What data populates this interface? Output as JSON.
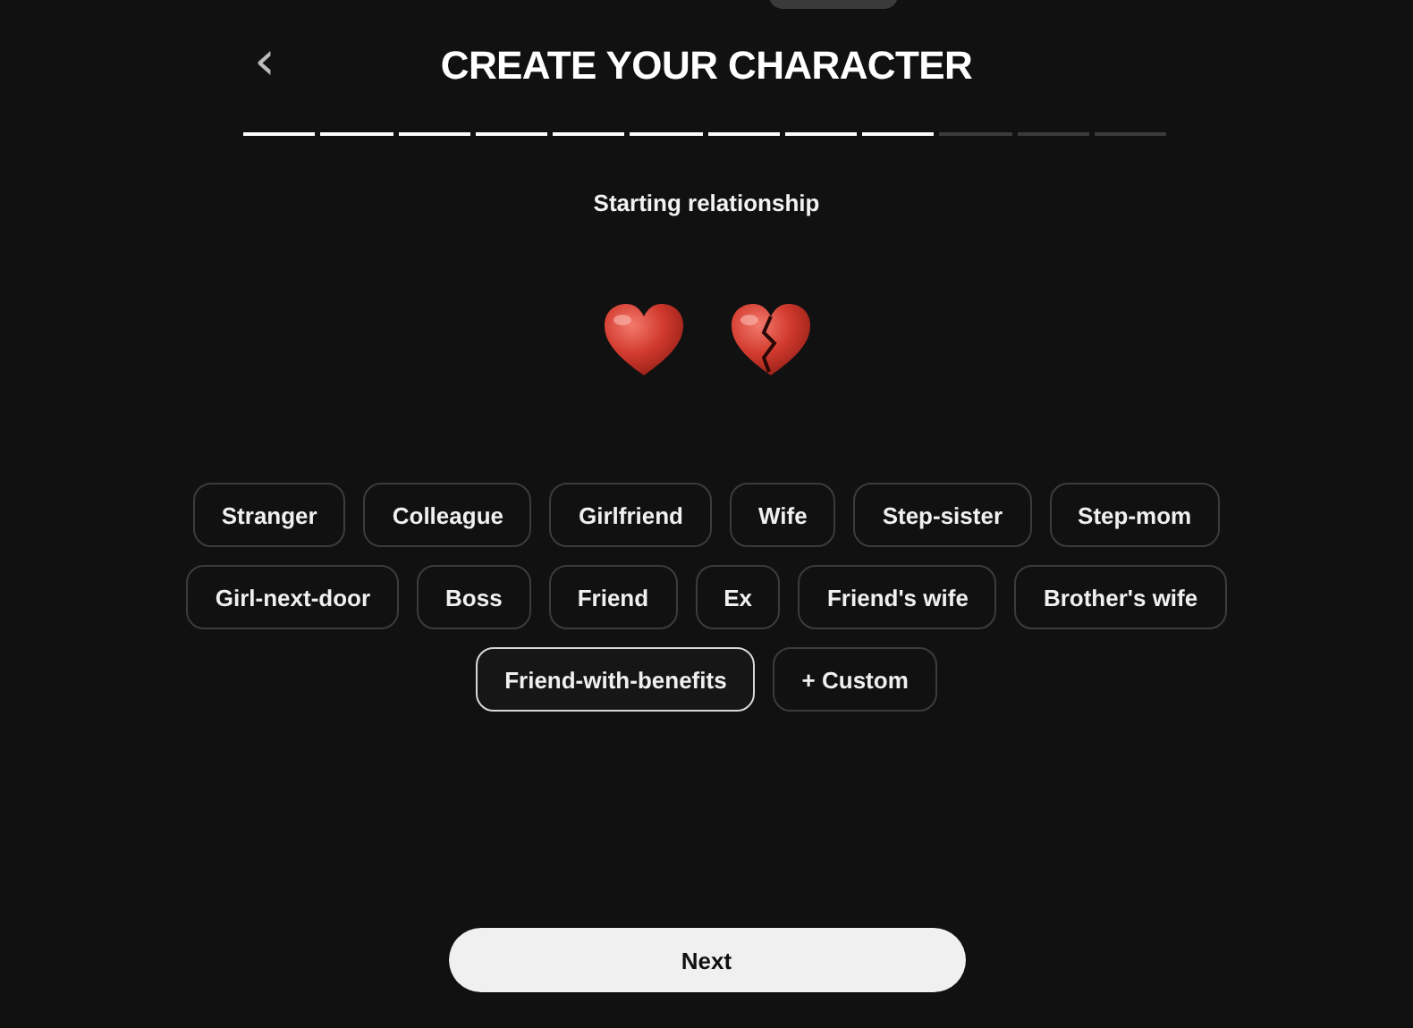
{
  "header": {
    "back": "‹",
    "title": "CREATE YOUR CHARACTER"
  },
  "progress": [
    {
      "done": true
    },
    {
      "done": true
    },
    {
      "done": true
    },
    {
      "done": true
    },
    {
      "done": true
    },
    {
      "done": true
    },
    {
      "done": true
    },
    {
      "done": true
    },
    {
      "done": true
    },
    {
      "done": false
    },
    {
      "done": false
    },
    {
      "done": false
    }
  ],
  "section": {
    "title": "Starting relationship"
  },
  "option_rows": [
    [
      {
        "label": "Stranger",
        "selected": false
      },
      {
        "label": "Colleague",
        "selected": false
      },
      {
        "label": "Girlfriend",
        "selected": false
      },
      {
        "label": "Wife",
        "selected": false
      },
      {
        "label": "Step-sister",
        "selected": false
      },
      {
        "label": "Step-mom",
        "selected": false
      }
    ],
    [
      {
        "label": "Girl-next-door",
        "selected": false
      },
      {
        "label": "Boss",
        "selected": false
      },
      {
        "label": "Friend",
        "selected": false
      },
      {
        "label": "Ex",
        "selected": false
      },
      {
        "label": "Friend's wife",
        "selected": false
      },
      {
        "label": "Brother's wife",
        "selected": false
      }
    ],
    [
      {
        "label": "Friend-with-benefits",
        "selected": true
      },
      {
        "label": "+ Custom",
        "selected": false
      }
    ]
  ],
  "next_button": {
    "label": "Next"
  }
}
